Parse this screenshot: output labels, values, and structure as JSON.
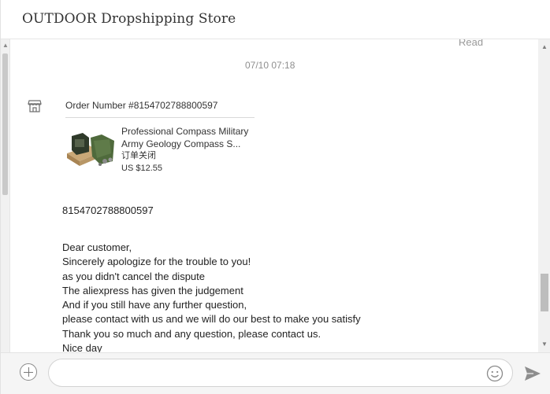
{
  "header": {
    "store_name": "OUTDOOR Dropshipping Store"
  },
  "chat": {
    "read_status": "Read",
    "timestamp": "07/10 07:18",
    "order_card": {
      "order_number": "Order Number #8154702788800597",
      "product_name": "Professional Compass Military Army Geology Compass S...",
      "status": "订单关闭",
      "price": "US $12.55"
    },
    "message_order_id": "8154702788800597",
    "message_lines": [
      "Dear customer,",
      "Sincerely apologize for the trouble to you!",
      "as you didn't cancel the dispute",
      "The aliexpress has given the judgement",
      "And if you still have any further question,",
      "please contact with us and we will do our best to make you satisfy",
      "Thank you so much and any question, please contact us.",
      "Nice day"
    ]
  },
  "input_bar": {
    "message_value": "",
    "add_icon": "plus-circle-icon",
    "emoji_icon": "smiley-icon",
    "send_icon": "send-arrow-icon"
  },
  "icons": {
    "shop": "storefront-icon"
  },
  "colors": {
    "timestamp_gray": "#8f8f8f",
    "scroll_thumb": "#bdbdbd"
  }
}
